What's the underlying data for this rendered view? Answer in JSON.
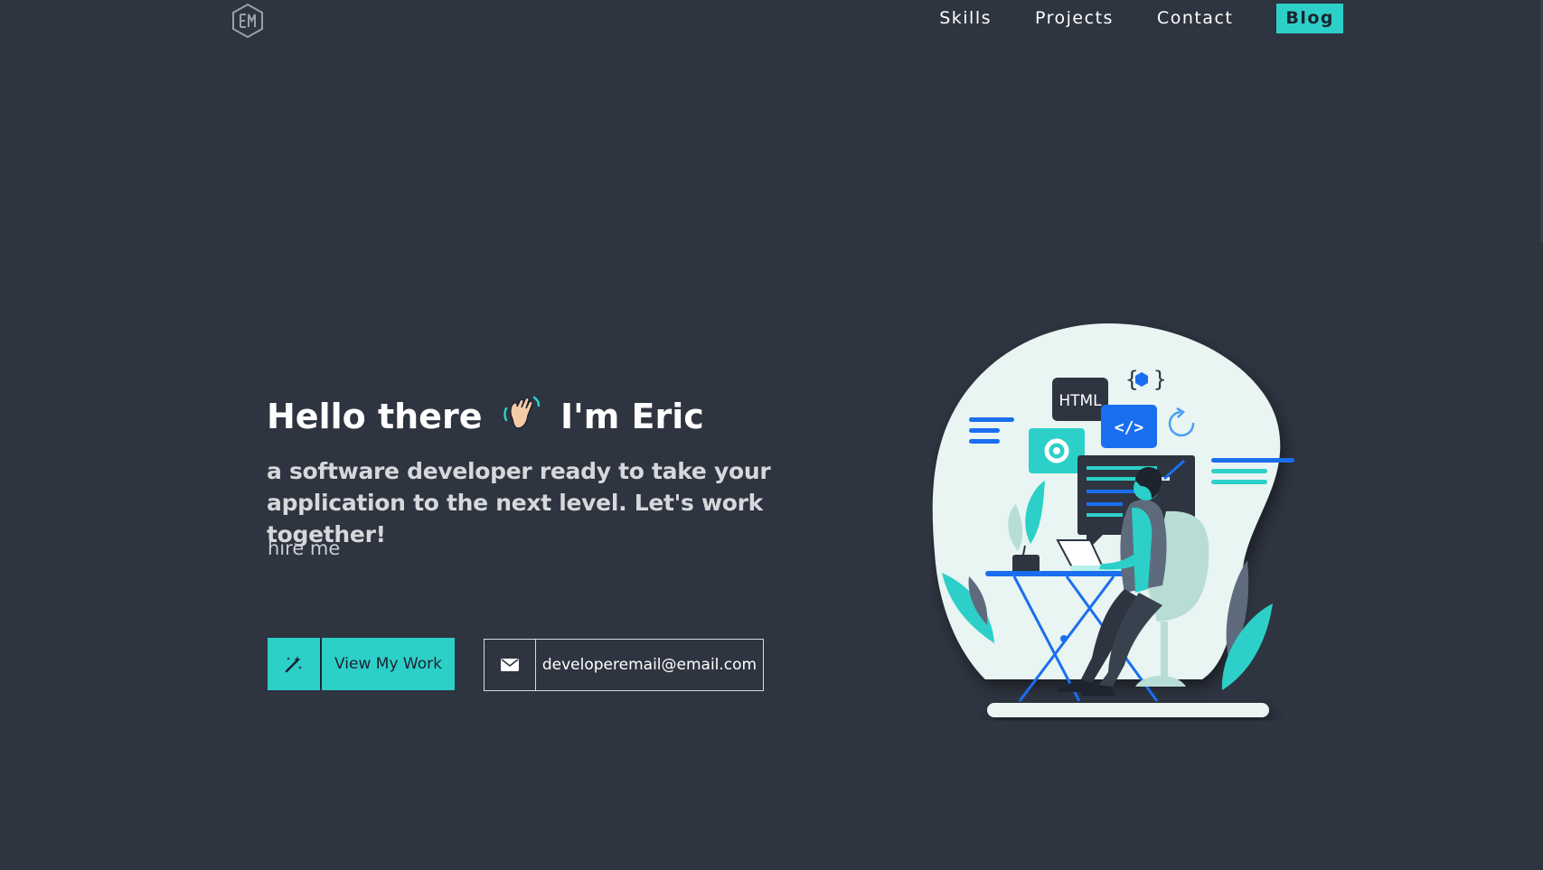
{
  "nav": {
    "logo_alt": "EM",
    "items": [
      {
        "label": "Skills"
      },
      {
        "label": "Projects"
      },
      {
        "label": "Contact"
      },
      {
        "label": "Blog"
      }
    ]
  },
  "hero": {
    "greeting_before": "Hello there",
    "greeting_after": "I'm Eric",
    "subtitle": "a software developer ready to take your application to the next level. Let's work together!",
    "hire_text": "hire me"
  },
  "buttons": {
    "work_label": "View My Work",
    "work_icon": "magic-wand-icon",
    "email_label": "developeremail@email.com",
    "email_icon": "envelope-icon"
  },
  "illustration": {
    "html_tag": "HTML",
    "code_tag": "</>"
  },
  "colors": {
    "background": "#2e3440",
    "accent": "#2cd0c8",
    "blue": "#1a6ef0",
    "text": "#ffffff"
  }
}
